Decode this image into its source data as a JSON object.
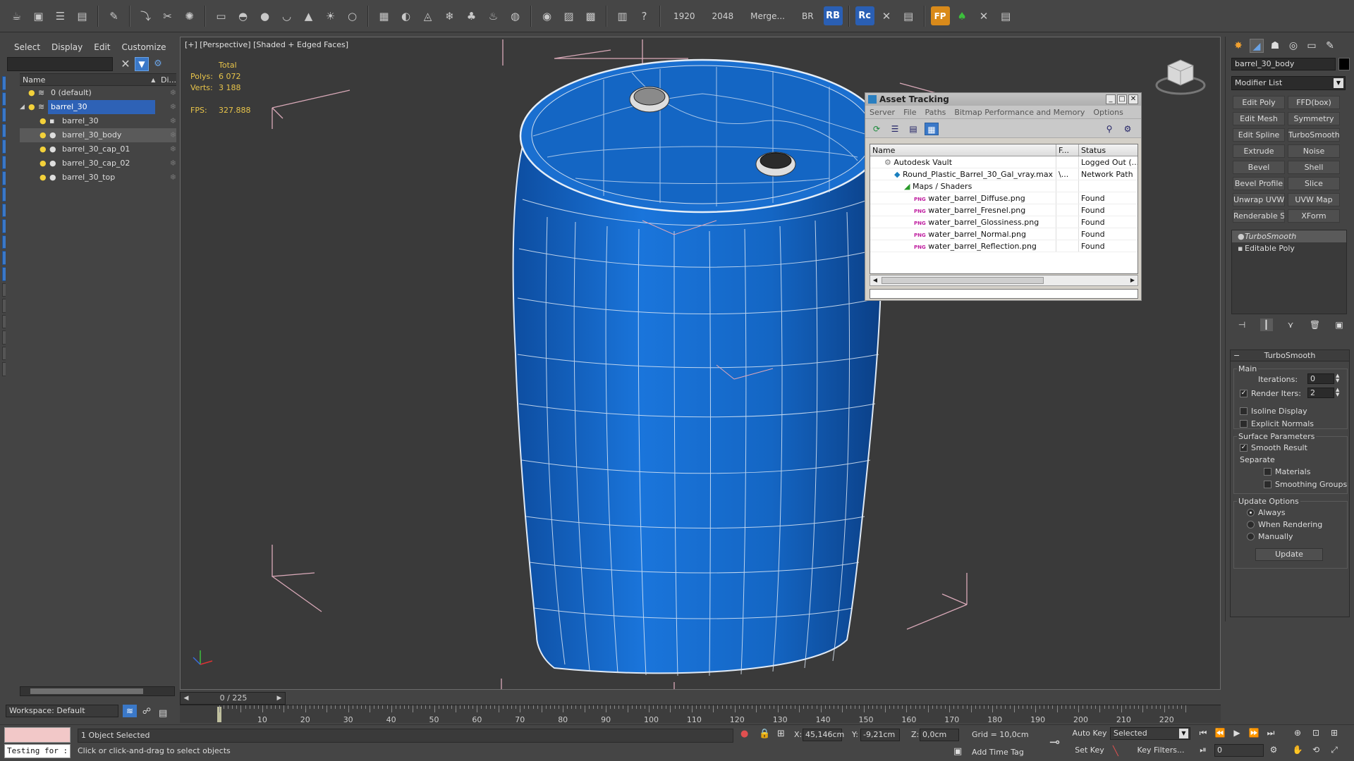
{
  "toolbar": {
    "resolution_width": "1920",
    "resolution_height": "2048",
    "merge_label": "Merge...",
    "br_label": "BR",
    "rb_label": "RB",
    "rc_label": "Rc",
    "fp_label": "FP"
  },
  "scene_explorer": {
    "menu": [
      "Select",
      "Display",
      "Edit",
      "Customize"
    ],
    "search_value": "",
    "col_name": "Name",
    "col_display": "Di...",
    "rows": [
      {
        "label": "0 (default)",
        "icon": "layer-icon"
      },
      {
        "label": "barrel_30",
        "icon": "layer-icon"
      },
      {
        "label": "barrel_30",
        "icon": "helper-icon"
      },
      {
        "label": "barrel_30_body",
        "icon": "sphere-icon"
      },
      {
        "label": "barrel_30_cap_01",
        "icon": "sphere-icon"
      },
      {
        "label": "barrel_30_cap_02",
        "icon": "sphere-icon"
      },
      {
        "label": "barrel_30_top",
        "icon": "sphere-icon"
      }
    ],
    "workspace": "Workspace: Default"
  },
  "viewport": {
    "label": "[+] [Perspective] [Shaded + Edged Faces]",
    "stats_total": "Total",
    "polys_label": "Polys:",
    "polys_value": "6 072",
    "verts_label": "Verts:",
    "verts_value": "3 188",
    "fps_label": "FPS:",
    "fps_value": "327.888",
    "barrel_color": "#1467c8"
  },
  "asset_tracking": {
    "title": "Asset Tracking",
    "menu": [
      "Server",
      "File",
      "Paths",
      "Bitmap Performance and Memory",
      "Options"
    ],
    "columns": [
      "Name",
      "F...",
      "Status"
    ],
    "rows": [
      {
        "name": "Autodesk Vault",
        "f": "",
        "status": "Logged Out (...",
        "indent": 1
      },
      {
        "name": "Round_Plastic_Barrel_30_Gal_vray.max",
        "f": "\\...",
        "status": "Network Path",
        "indent": 2
      },
      {
        "name": "Maps / Shaders",
        "f": "",
        "status": "",
        "indent": 3
      },
      {
        "name": "water_barrel_Diffuse.png",
        "f": "",
        "status": "Found",
        "indent": 4
      },
      {
        "name": "water_barrel_Fresnel.png",
        "f": "",
        "status": "Found",
        "indent": 4
      },
      {
        "name": "water_barrel_Glossiness.png",
        "f": "",
        "status": "Found",
        "indent": 4
      },
      {
        "name": "water_barrel_Normal.png",
        "f": "",
        "status": "Found",
        "indent": 4
      },
      {
        "name": "water_barrel_Reflection.png",
        "f": "",
        "status": "Found",
        "indent": 4
      }
    ],
    "png_badge": "PNG"
  },
  "command_panel": {
    "object_name": "barrel_30_body",
    "modifier_list": "Modifier List",
    "buttons": [
      "Edit Poly",
      "FFD(box)",
      "Edit Mesh",
      "Symmetry",
      "Edit Spline",
      "TurboSmooth",
      "Extrude",
      "Noise",
      "Bevel",
      "Shell",
      "Bevel Profile",
      "Slice",
      "Unwrap UVW",
      "UVW Map",
      "Renderable Spline",
      "XForm"
    ],
    "stack": [
      "TurboSmooth",
      "Editable Poly"
    ],
    "turbosmooth": {
      "title": "TurboSmooth",
      "main": "Main",
      "iterations_label": "Iterations:",
      "iterations_value": "0",
      "render_iters_label": "Render Iters:",
      "render_iters_value": "2",
      "isoline": "Isoline Display",
      "explicit": "Explicit Normals",
      "surface_params": "Surface Parameters",
      "smooth_result": "Smooth Result",
      "separate": "Separate",
      "materials": "Materials",
      "smoothing_groups": "Smoothing Groups",
      "update_options": "Update Options",
      "always": "Always",
      "when_rendering": "When Rendering",
      "manually": "Manually",
      "update": "Update"
    }
  },
  "timeline": {
    "slider_label": "0 / 225",
    "ticks": [
      "10",
      "20",
      "30",
      "40",
      "50",
      "60",
      "70",
      "80",
      "90",
      "100",
      "110",
      "120",
      "130",
      "140",
      "150",
      "160",
      "170",
      "180",
      "190",
      "200",
      "210",
      "220"
    ]
  },
  "statusbar": {
    "listener": "Testing for :",
    "selection": "1 Object Selected",
    "prompt": "Click or click-and-drag to select objects",
    "x_label": "X:",
    "x_value": "45,146cm",
    "y_label": "Y:",
    "y_value": "-9,21cm",
    "z_label": "Z:",
    "z_value": "0,0cm",
    "grid": "Grid = 10,0cm",
    "add_time_tag": "Add Time Tag",
    "auto_key": "Auto Key",
    "set_key": "Set Key",
    "selected": "Selected",
    "key_filters": "Key Filters...",
    "frame": "0"
  }
}
